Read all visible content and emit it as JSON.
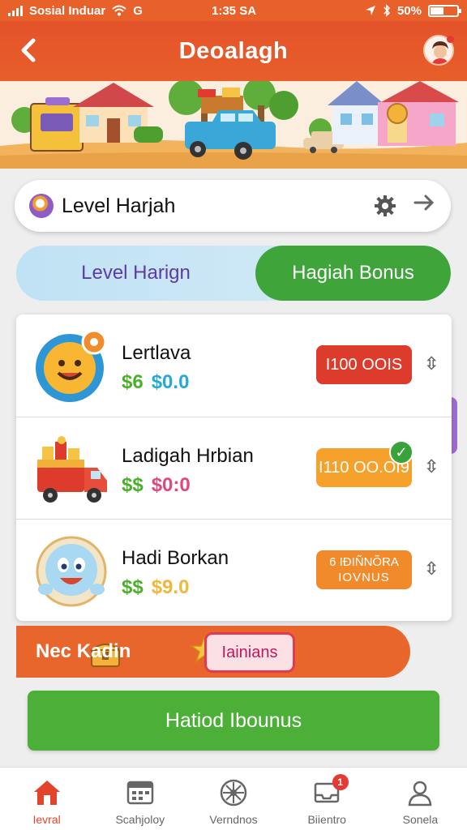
{
  "status_bar": {
    "carrier": "Sosial Induar",
    "network": "G",
    "time": "1:35 SA",
    "battery": "50%"
  },
  "header": {
    "title": "Deoalagh"
  },
  "level_bar": {
    "title": "Level Harjah"
  },
  "tabs": [
    {
      "label": "Level Harign",
      "active": false
    },
    {
      "label": "Hagiah Bonus",
      "active": true
    }
  ],
  "rewards": [
    {
      "name": "Lertlava",
      "amount_a": "$6",
      "amount_b": "$0.0",
      "amount_b_color": "#26a9d8",
      "button": "I100 OOIS",
      "button_color": "#dd3b2b"
    },
    {
      "name": "Ladigah Hrbian",
      "amount_a": "$$",
      "amount_b": "$0:0",
      "amount_b_color": "#e2477c",
      "button": "I110 OO.OI9",
      "button_color": "#f5a12b"
    },
    {
      "name": "Hadi Borkan",
      "amount_a": "$$",
      "amount_b": "$9.0",
      "amount_b_color": "#f0b83a",
      "button_line1": "6 IÐIÑNÕRA",
      "button_line2": "IOVNUS",
      "button_color": "#f08a2b"
    }
  ],
  "promo": {
    "text": "Nec   Kadin",
    "tag": "Iainians"
  },
  "cta": {
    "label": "Hatiod Ibounus"
  },
  "bottom_nav": [
    {
      "label": "Ievral",
      "icon": "home-icon",
      "active": true
    },
    {
      "label": "Scahjoloy",
      "icon": "calendar-icon",
      "active": false
    },
    {
      "label": "Verndnos",
      "icon": "wheel-icon",
      "active": false
    },
    {
      "label": "Biientro",
      "icon": "inbox-icon",
      "active": false,
      "badge": "1"
    },
    {
      "label": "Sonela",
      "icon": "profile-icon",
      "active": false
    }
  ]
}
